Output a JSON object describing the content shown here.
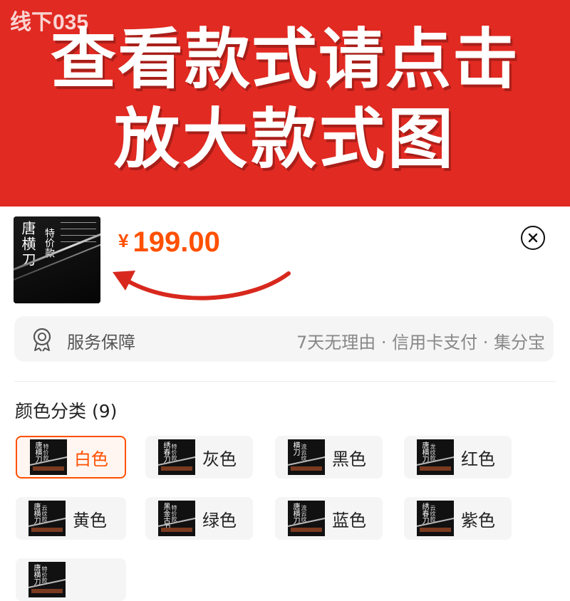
{
  "banner": {
    "watermark": "线下035",
    "line1": "查看款式请点击",
    "line2": "放大款式图"
  },
  "product": {
    "thumb_title": "唐横刀",
    "thumb_subtitle": "特价款",
    "currency": "¥",
    "price": "199.00",
    "price_color": "#ff5000"
  },
  "service": {
    "icon": "medal-icon",
    "label": "服务保障",
    "detail": "7天无理由 · 信用卡支付 · 集分宝"
  },
  "options": {
    "title": "颜色分类 (9)",
    "items": [
      {
        "label": "白色",
        "thumb_a": "唐横刀",
        "thumb_b": "特价款",
        "selected": true
      },
      {
        "label": "灰色",
        "thumb_a": "绣春刀",
        "thumb_b": "特价款",
        "selected": false
      },
      {
        "label": "黑色",
        "thumb_a": "横刀",
        "thumb_b": "流云纹",
        "selected": false
      },
      {
        "label": "红色",
        "thumb_a": "唐横刀",
        "thumb_b": "龙纹款",
        "selected": false
      },
      {
        "label": "黄色",
        "thumb_a": "唐横刀",
        "thumb_b": "云纹款",
        "selected": false
      },
      {
        "label": "绿色",
        "thumb_a": "黑金古刀",
        "thumb_b": "特价款",
        "selected": false
      },
      {
        "label": "蓝色",
        "thumb_a": "唐横刀",
        "thumb_b": "流云纹",
        "selected": false
      },
      {
        "label": "紫色",
        "thumb_a": "绣春刀",
        "thumb_b": "云纹款",
        "selected": false
      },
      {
        "label": "",
        "thumb_a": "唐横刀",
        "thumb_b": "特价款",
        "selected": false
      }
    ]
  },
  "icons": {
    "close": "close-icon"
  }
}
